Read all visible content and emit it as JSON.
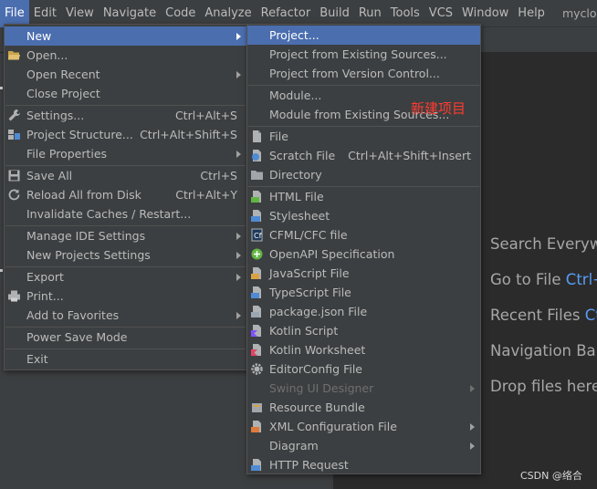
{
  "menubar": {
    "items": [
      "File",
      "Edit",
      "View",
      "Navigate",
      "Code",
      "Analyze",
      "Refactor",
      "Build",
      "Run",
      "Tools",
      "VCS",
      "Window",
      "Help"
    ],
    "project": "myclou"
  },
  "file_menu": {
    "new": "New",
    "open": "Open...",
    "open_recent": "Open Recent",
    "close_project": "Close Project",
    "settings": "Settings...",
    "settings_sc": "Ctrl+Alt+S",
    "project_structure": "Project Structure...",
    "project_structure_sc": "Ctrl+Alt+Shift+S",
    "file_properties": "File Properties",
    "save_all": "Save All",
    "save_all_sc": "Ctrl+S",
    "reload": "Reload All from Disk",
    "reload_sc": "Ctrl+Alt+Y",
    "invalidate": "Invalidate Caches / Restart...",
    "manage_ide": "Manage IDE Settings",
    "new_projects_settings": "New Projects Settings",
    "export": "Export",
    "print": "Print...",
    "add_favorites": "Add to Favorites",
    "power_save": "Power Save Mode",
    "exit": "Exit"
  },
  "new_menu": {
    "project": "Project...",
    "from_existing": "Project from Existing Sources...",
    "from_vcs": "Project from Version Control...",
    "module": "Module...",
    "module_existing": "Module from Existing Sources...",
    "file": "File",
    "scratch": "Scratch File",
    "scratch_sc": "Ctrl+Alt+Shift+Insert",
    "directory": "Directory",
    "html": "HTML File",
    "stylesheet": "Stylesheet",
    "cfml": "CFML/CFC file",
    "openapi": "OpenAPI Specification",
    "javascript": "JavaScript File",
    "typescript": "TypeScript File",
    "packagejson": "package.json File",
    "kotlin_script": "Kotlin Script",
    "kotlin_worksheet": "Kotlin Worksheet",
    "editorconfig": "EditorConfig File",
    "swing": "Swing UI Designer",
    "resource_bundle": "Resource Bundle",
    "xml_config": "XML Configuration File",
    "diagram": "Diagram",
    "http": "HTTP Request"
  },
  "annotation": "新建项目",
  "hints": {
    "search": "Search Everywh",
    "goto_file": "Go to File",
    "goto_file_key": "Ctrl+",
    "recent": "Recent Files",
    "recent_key": "Ct",
    "navbar": "Navigation Bar",
    "drop": "Drop files here"
  },
  "watermark": "CSDN @络合",
  "colors": {
    "selection": "#4b6eaf",
    "menu_bg": "#3c3f41",
    "annotation": "#ff3b30",
    "shortcut_key": "#589df6"
  }
}
